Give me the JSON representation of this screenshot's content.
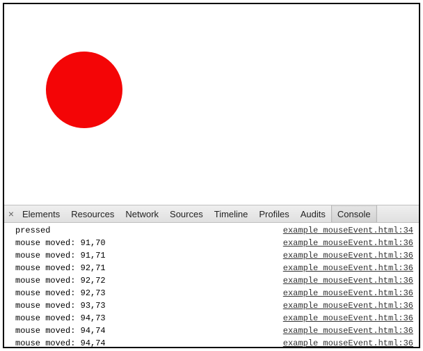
{
  "viewport": {
    "circle": {
      "name": "red-circle"
    }
  },
  "devtools": {
    "close_label": "×",
    "tabs": [
      {
        "label": "Elements",
        "active": false
      },
      {
        "label": "Resources",
        "active": false
      },
      {
        "label": "Network",
        "active": false
      },
      {
        "label": "Sources",
        "active": false
      },
      {
        "label": "Timeline",
        "active": false
      },
      {
        "label": "Profiles",
        "active": false
      },
      {
        "label": "Audits",
        "active": false
      },
      {
        "label": "Console",
        "active": true
      }
    ],
    "console": [
      {
        "message": "pressed",
        "source": "example mouseEvent.html:34"
      },
      {
        "message": "mouse moved: 91,70",
        "source": "example mouseEvent.html:36"
      },
      {
        "message": "mouse moved: 91,71",
        "source": "example mouseEvent.html:36"
      },
      {
        "message": "mouse moved: 92,71",
        "source": "example mouseEvent.html:36"
      },
      {
        "message": "mouse moved: 92,72",
        "source": "example mouseEvent.html:36"
      },
      {
        "message": "mouse moved: 92,73",
        "source": "example mouseEvent.html:36"
      },
      {
        "message": "mouse moved: 93,73",
        "source": "example mouseEvent.html:36"
      },
      {
        "message": "mouse moved: 94,73",
        "source": "example mouseEvent.html:36"
      },
      {
        "message": "mouse moved: 94,74",
        "source": "example mouseEvent.html:36"
      },
      {
        "message": "mouse moved: 94,74",
        "source": "example mouseEvent.html:36"
      }
    ]
  }
}
